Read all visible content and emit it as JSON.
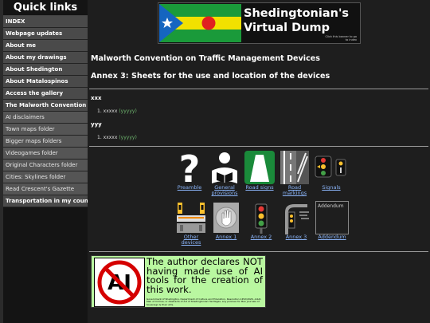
{
  "sidebar": {
    "title": "Quick links",
    "items": [
      {
        "label": "INDEX",
        "bold": true
      },
      {
        "label": "Webpage updates",
        "bold": true
      },
      {
        "label": "About me",
        "bold": true
      },
      {
        "label": "About my drawings",
        "bold": true
      },
      {
        "label": "About Shedington",
        "bold": true
      },
      {
        "label": "About Matalospinos",
        "bold": true
      },
      {
        "label": "Access the gallery",
        "bold": true
      },
      {
        "label": "The Malworth Convention",
        "bold": true
      },
      {
        "label": "AI disclaimers",
        "bold": false
      },
      {
        "label": "Town maps folder",
        "bold": false
      },
      {
        "label": "Bigger maps folders",
        "bold": false
      },
      {
        "label": "Videogames folder",
        "bold": false
      },
      {
        "label": "Original Characters folder",
        "bold": false
      },
      {
        "label": "Cities: Skylines folder",
        "bold": false
      },
      {
        "label": "Read Crescent's Gazette",
        "bold": false
      },
      {
        "label": "Transportation in my countries",
        "bold": true
      }
    ]
  },
  "banner": {
    "title_line1": "Shedingtonian's",
    "title_line2": "Virtual Dump",
    "note": "Click this banner to go to index"
  },
  "page": {
    "title": "Malworth Convention on Traffic Management Devices",
    "subtitle": "Annex 3: Sheets for the use and location of the devices",
    "sections": [
      {
        "label": "xxx",
        "item_num": "1.",
        "item_text": "xxxxx",
        "item_paren": "(yyyyy)"
      },
      {
        "label": "yyy",
        "item_num": "1.",
        "item_text": "xxxxx",
        "item_paren": "(yyyyy)"
      }
    ]
  },
  "icons": {
    "row1": [
      {
        "name": "preamble",
        "label": "Preamble"
      },
      {
        "name": "general-provisions",
        "label": "General provisions"
      },
      {
        "name": "road-signs",
        "label": "Road signs"
      },
      {
        "name": "road-markings",
        "label": "Road markings"
      },
      {
        "name": "signals",
        "label": "Signals"
      }
    ],
    "row2": [
      {
        "name": "other-devices",
        "label": "Other devices"
      },
      {
        "name": "annex-1",
        "label": "Annex 1"
      },
      {
        "name": "annex-2",
        "label": "Annex 2"
      },
      {
        "name": "annex-3",
        "label": "Annex 3"
      },
      {
        "name": "addendum",
        "label": "Addendum",
        "alt": "Addendum"
      }
    ]
  },
  "ai_notice": {
    "text": "The author declares NOT having made use of AI tools for the creation of this work.",
    "sign_text": "AI",
    "small": "Government of Shedington, Department of Culture and Education. Resolution 1452/2026. Adult, Men of Crimes, or Abstracts of Art of Shedingtonian Heritages, any policies for Men Journals of Sovereign & their Arts."
  },
  "colors": {
    "sidebar_bg": "#141414",
    "main_bg": "#1e1e1e",
    "link": "#8ab4f8",
    "ai_banner": "#b9f7a0"
  }
}
